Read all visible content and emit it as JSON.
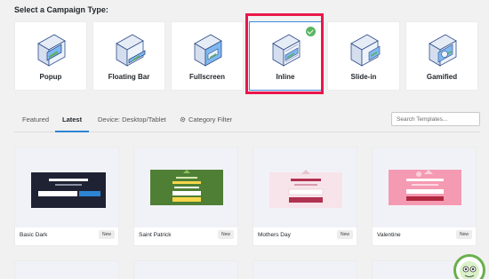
{
  "heading": "Select a Campaign Type:",
  "campaign_types": [
    {
      "label": "Popup",
      "icon": "popup-icon"
    },
    {
      "label": "Floating Bar",
      "icon": "floating-bar-icon"
    },
    {
      "label": "Fullscreen",
      "icon": "fullscreen-icon"
    },
    {
      "label": "Inline",
      "icon": "inline-icon",
      "selected": true
    },
    {
      "label": "Slide-in",
      "icon": "slide-in-icon"
    },
    {
      "label": "Gamified",
      "icon": "gamified-icon"
    }
  ],
  "tabs": {
    "featured": "Featured",
    "latest": "Latest",
    "device": "Device: Desktop/Tablet",
    "category": "Category Filter"
  },
  "search": {
    "placeholder": "Search Templates..."
  },
  "templates": [
    {
      "name": "Basic Dark",
      "badge": "New"
    },
    {
      "name": "Saint Patrick",
      "badge": "New"
    },
    {
      "name": "Mothers Day",
      "badge": "New"
    },
    {
      "name": "Valentine",
      "badge": "New"
    }
  ],
  "colors": {
    "highlight": "#e8174b",
    "accent": "#2d84d3",
    "check": "#5bb662"
  }
}
